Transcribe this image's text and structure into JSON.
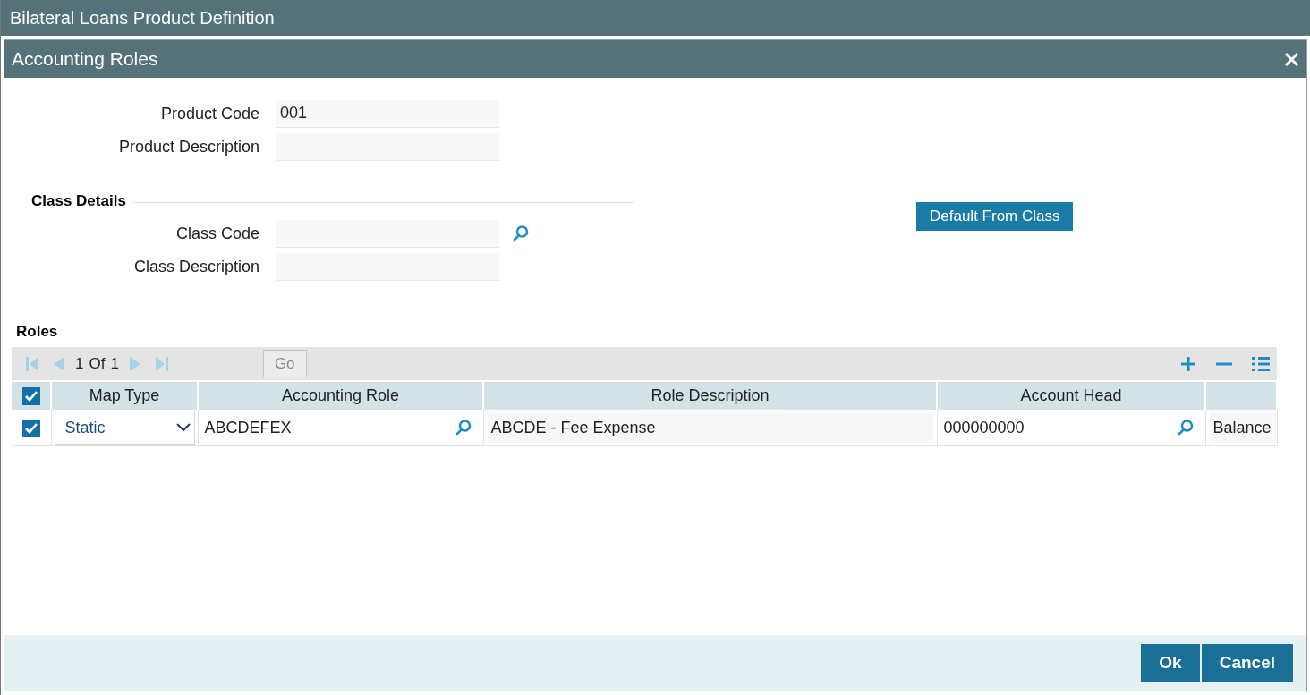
{
  "window": {
    "title": "Bilateral Loans Product Definition"
  },
  "dialog": {
    "title": "Accounting Roles"
  },
  "product_fields": [
    {
      "label": "Product Code",
      "value": "001",
      "lookup": false
    },
    {
      "label": "Product Description",
      "lookup": false
    }
  ],
  "class_details": {
    "title": "Class Details",
    "fields": [
      {
        "label": "Class Code",
        "lookup": true
      },
      {
        "label": "Class Description",
        "lookup": false
      }
    ]
  },
  "default_button": "Default From Class",
  "roles": {
    "title": "Roles",
    "pager": {
      "current": "1",
      "of": "Of",
      "total": "1",
      "go": "Go"
    },
    "select_all_checked": true,
    "columns": [
      "Map Type",
      "Accounting Role",
      "Role Description",
      "Account Head"
    ],
    "rows": [
      {
        "checked": true,
        "map_type": "Static",
        "accounting_role": "ABCDEFEX",
        "role_description": "ABCDE - Fee Expense",
        "account_head": "000000000",
        "column_5": "Balance"
      }
    ]
  },
  "buttons": [
    {
      "label": "Ok"
    },
    {
      "label": "Cancel"
    }
  ]
}
